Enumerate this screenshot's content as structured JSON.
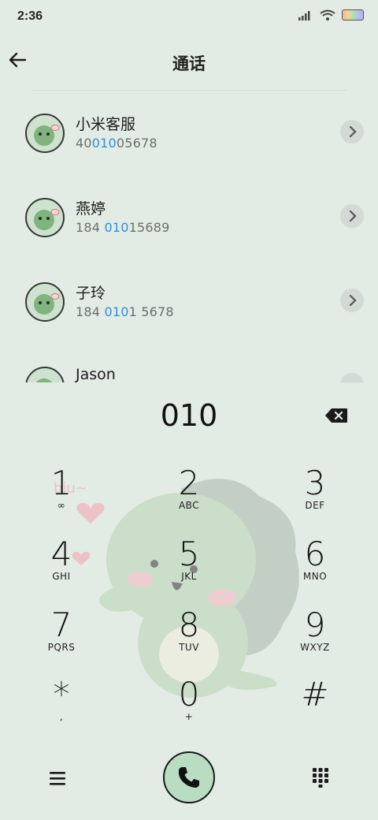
{
  "status": {
    "time": "2:36"
  },
  "header": {
    "title": "通话"
  },
  "contacts": [
    {
      "name": "小米客服",
      "num_pre": "40",
      "num_hl": "010",
      "num_post": "05678"
    },
    {
      "name": "燕婷",
      "num_pre": "184 ",
      "num_hl": "010",
      "num_post": "15689"
    },
    {
      "name": "子玲",
      "num_pre": "184 ",
      "num_hl": "010",
      "num_post": "1 5678"
    },
    {
      "name": "Jason",
      "num_pre": "",
      "num_hl": "",
      "num_post": ""
    }
  ],
  "dial": {
    "input": "010"
  },
  "keys": [
    {
      "num": "1",
      "sub": "∞"
    },
    {
      "num": "2",
      "sub": "ABC"
    },
    {
      "num": "3",
      "sub": "DEF"
    },
    {
      "num": "4",
      "sub": "GHI"
    },
    {
      "num": "5",
      "sub": "JKL"
    },
    {
      "num": "6",
      "sub": "MNO"
    },
    {
      "num": "7",
      "sub": "PQRS"
    },
    {
      "num": "8",
      "sub": "TUV"
    },
    {
      "num": "9",
      "sub": "WXYZ"
    },
    {
      "num": "*",
      "sub": ","
    },
    {
      "num": "0",
      "sub": "+"
    },
    {
      "num": "#",
      "sub": ""
    }
  ],
  "icons": {
    "back": "back-arrow-icon",
    "delete": "backspace-icon",
    "menu": "menu-icon",
    "call": "phone-icon",
    "dialpad": "dialpad-icon"
  },
  "colors": {
    "accent": "#2f8fe0",
    "background": "#e3ebe5",
    "call_button": "#b9ddc3"
  }
}
